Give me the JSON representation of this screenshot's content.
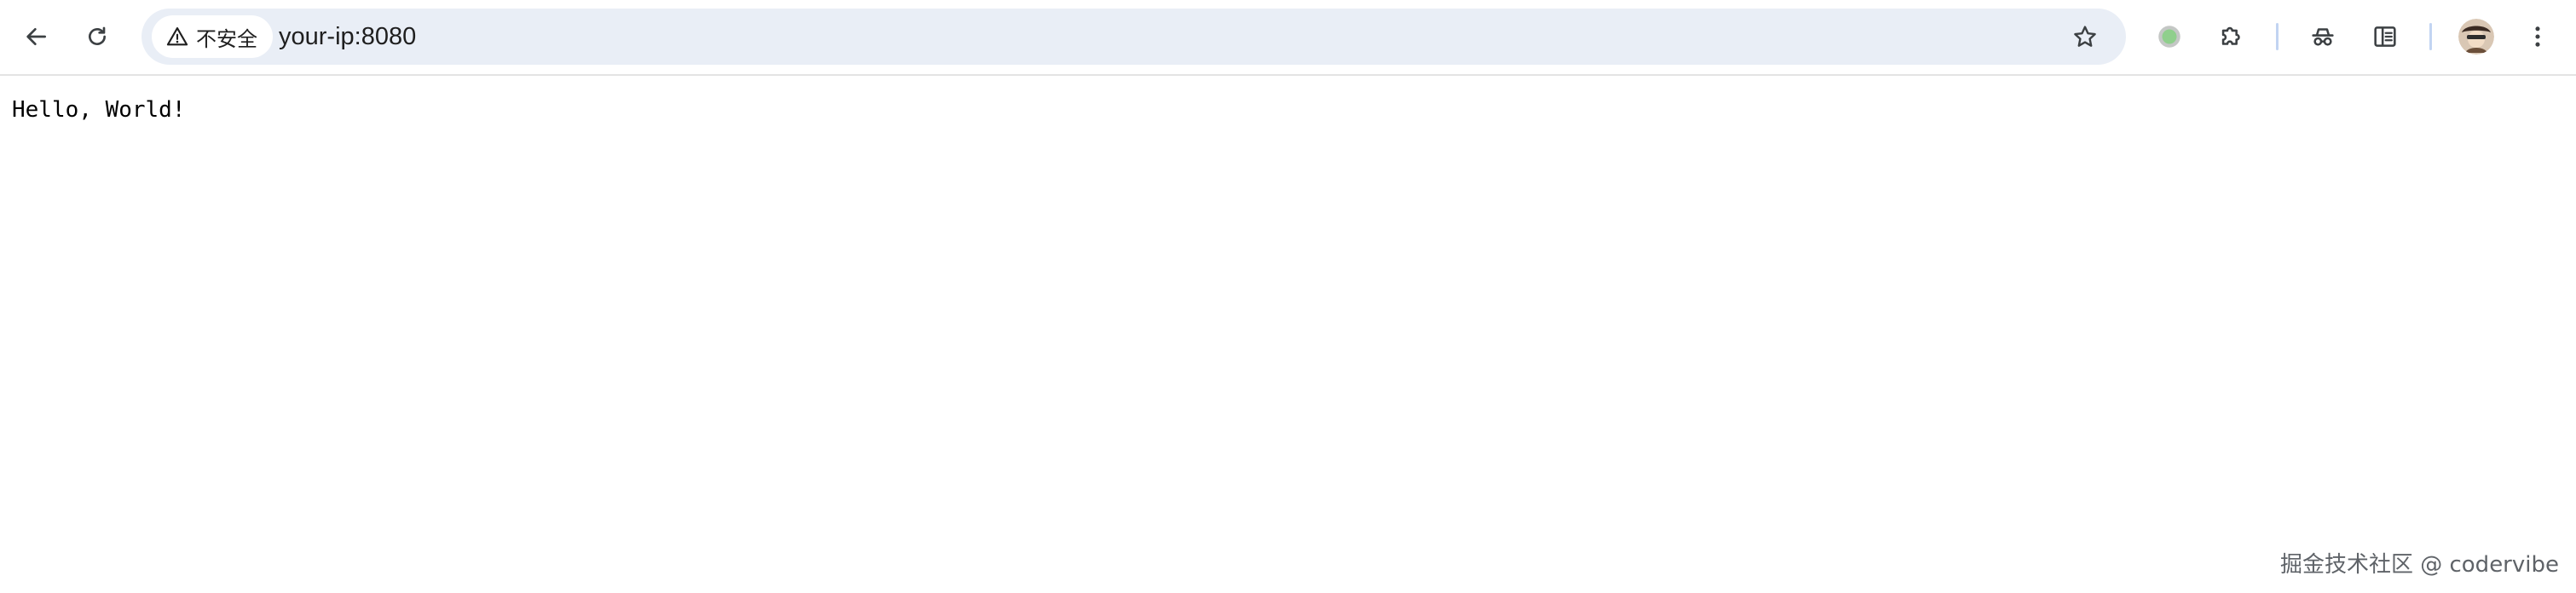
{
  "browser": {
    "security_label": "不安全",
    "url": "your-ip:8080"
  },
  "page": {
    "body_text": "Hello, World!"
  },
  "watermark": {
    "text": "掘金技术社区 @ codervibe"
  },
  "icons": {
    "back": "back-arrow-icon",
    "reload": "reload-icon",
    "warning": "warning-icon",
    "bookmark": "star-icon",
    "extension_status": "green-circle-icon",
    "extensions": "puzzle-icon",
    "incognito": "spy-icon",
    "reading_list": "reading-list-icon",
    "profile": "avatar",
    "menu": "kebab-menu-icon"
  },
  "colors": {
    "omnibox_bg": "#e9eef6",
    "text": "#1f1f1f",
    "status_green": "#8fcf8c"
  }
}
